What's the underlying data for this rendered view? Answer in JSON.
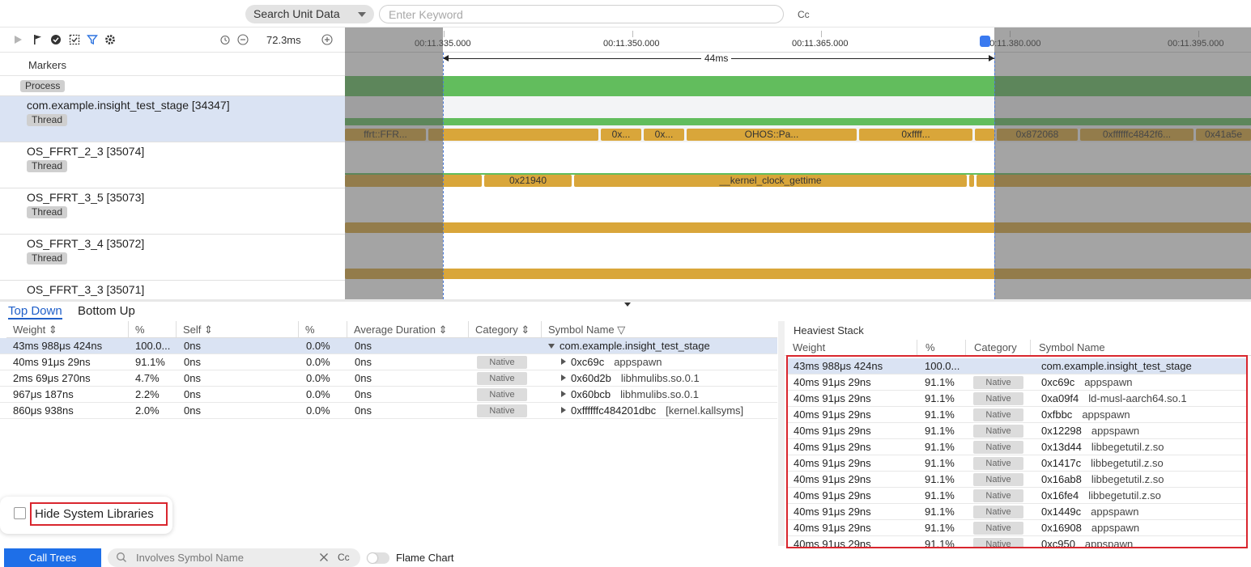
{
  "topbar": {
    "unit_select": "Search Unit Data",
    "keyword_placeholder": "Enter Keyword",
    "case_toggle": "Cc"
  },
  "toolbar": {
    "zoom_value": "72.3ms",
    "icons": [
      "play-icon",
      "flag-icon",
      "record-icon",
      "screenshot-icon",
      "filter-icon",
      "settings-icon",
      "history-icon",
      "zoom-out-icon",
      "zoom-in-icon"
    ]
  },
  "timeline": {
    "ticks": [
      "00:11.335.000",
      "00:11.350.000",
      "00:11.365.000",
      "00:11.380.000",
      "00:11.395.000"
    ],
    "range_label": "44ms",
    "colors": {
      "thread_slice": "#d9a63a",
      "process_bar": "#62bd5d",
      "selection": "#4a7ad8"
    },
    "slices": {
      "main_thread": [
        "ffrt::FFR...",
        "0x...",
        "0x...",
        "OHOS::Pa...",
        "0xffff...",
        "0x872068",
        "0xffffffc4842f6...",
        "0x41a5e"
      ],
      "ffrt_2_3": [
        "0x21940",
        "__kernel_clock_gettime"
      ]
    }
  },
  "tracks": {
    "markers": "Markers",
    "process_tag": "Process",
    "items": [
      {
        "name": "com.example.insight_test_stage [34347]",
        "tag": "Thread"
      },
      {
        "name": "OS_FFRT_2_3 [35074]",
        "tag": "Thread"
      },
      {
        "name": "OS_FFRT_3_5 [35073]",
        "tag": "Thread"
      },
      {
        "name": "OS_FFRT_3_4 [35072]",
        "tag": "Thread"
      },
      {
        "name": "OS_FFRT_3_3 [35071]",
        "tag": ""
      }
    ]
  },
  "view_tabs": {
    "top_down": "Top Down",
    "bottom_up": "Bottom Up"
  },
  "calltree": {
    "headers": [
      "Weight",
      "%",
      "Self",
      "%",
      "Average Duration",
      "Category",
      "Symbol Name"
    ],
    "rows": [
      {
        "weight": "43ms 988μs 424ns",
        "pct": "100.0...",
        "self": "0ns",
        "self_pct": "0.0%",
        "avg": "0ns",
        "category": "",
        "addr": "com.example.insight_test_stage",
        "lib": "",
        "expanded": true
      },
      {
        "weight": "40ms 91μs 29ns",
        "pct": "91.1%",
        "self": "0ns",
        "self_pct": "0.0%",
        "avg": "0ns",
        "category": "Native",
        "addr": "0xc69c",
        "lib": "appspawn",
        "expanded": false
      },
      {
        "weight": "2ms 69μs 270ns",
        "pct": "4.7%",
        "self": "0ns",
        "self_pct": "0.0%",
        "avg": "0ns",
        "category": "Native",
        "addr": "0x60d2b",
        "lib": "libhmulibs.so.0.1",
        "expanded": false
      },
      {
        "weight": "967μs 187ns",
        "pct": "2.2%",
        "self": "0ns",
        "self_pct": "0.0%",
        "avg": "0ns",
        "category": "Native",
        "addr": "0x60bcb",
        "lib": "libhmulibs.so.0.1",
        "expanded": false
      },
      {
        "weight": "860μs 938ns",
        "pct": "2.0%",
        "self": "0ns",
        "self_pct": "0.0%",
        "avg": "0ns",
        "category": "Native",
        "addr": "0xffffffc484201dbc",
        "lib": "[kernel.kallsyms]",
        "expanded": false
      }
    ]
  },
  "heaviest": {
    "title": "Heaviest Stack",
    "headers": [
      "Weight",
      "%",
      "Category",
      "Symbol Name"
    ],
    "rows": [
      {
        "weight": "43ms 988μs 424ns",
        "pct": "100.0...",
        "category": "",
        "addr": "com.example.insight_test_stage",
        "lib": ""
      },
      {
        "weight": "40ms 91μs 29ns",
        "pct": "91.1%",
        "category": "Native",
        "addr": "0xc69c",
        "lib": "appspawn"
      },
      {
        "weight": "40ms 91μs 29ns",
        "pct": "91.1%",
        "category": "Native",
        "addr": "0xa09f4",
        "lib": "ld-musl-aarch64.so.1"
      },
      {
        "weight": "40ms 91μs 29ns",
        "pct": "91.1%",
        "category": "Native",
        "addr": "0xfbbc",
        "lib": "appspawn"
      },
      {
        "weight": "40ms 91μs 29ns",
        "pct": "91.1%",
        "category": "Native",
        "addr": "0x12298",
        "lib": "appspawn"
      },
      {
        "weight": "40ms 91μs 29ns",
        "pct": "91.1%",
        "category": "Native",
        "addr": "0x13d44",
        "lib": "libbegetutil.z.so"
      },
      {
        "weight": "40ms 91μs 29ns",
        "pct": "91.1%",
        "category": "Native",
        "addr": "0x1417c",
        "lib": "libbegetutil.z.so"
      },
      {
        "weight": "40ms 91μs 29ns",
        "pct": "91.1%",
        "category": "Native",
        "addr": "0x16ab8",
        "lib": "libbegetutil.z.so"
      },
      {
        "weight": "40ms 91μs 29ns",
        "pct": "91.1%",
        "category": "Native",
        "addr": "0x16fe4",
        "lib": "libbegetutil.z.so"
      },
      {
        "weight": "40ms 91μs 29ns",
        "pct": "91.1%",
        "category": "Native",
        "addr": "0x1449c",
        "lib": "appspawn"
      },
      {
        "weight": "40ms 91μs 29ns",
        "pct": "91.1%",
        "category": "Native",
        "addr": "0x16908",
        "lib": "appspawn"
      },
      {
        "weight": "40ms 91μs 29ns",
        "pct": "91.1%",
        "category": "Native",
        "addr": "0xc950",
        "lib": "appspawn"
      }
    ]
  },
  "footer": {
    "hide_system_libraries": "Hide System Libraries",
    "call_trees": "Call Trees",
    "symbol_placeholder": "Involves Symbol Name",
    "case_toggle": "Cc",
    "flame_chart": "Flame Chart"
  }
}
